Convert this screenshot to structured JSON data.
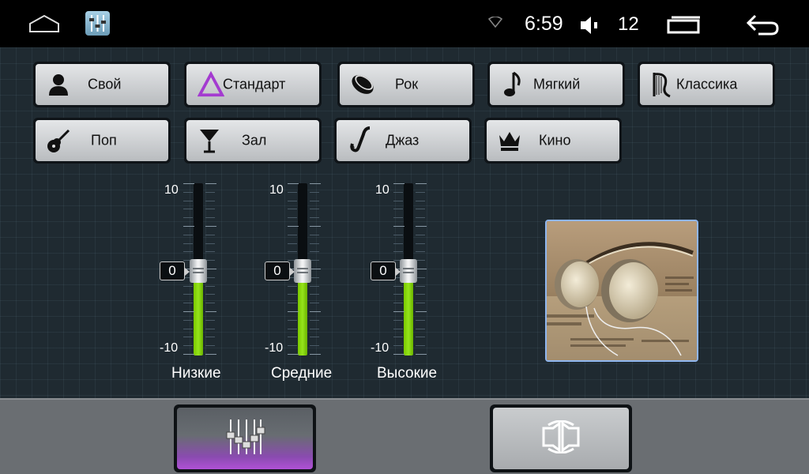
{
  "statusbar": {
    "time": "6:59",
    "volume": "12",
    "icons": [
      "home-icon",
      "equalizer-app-icon",
      "wifi-icon",
      "volume-icon",
      "recent-apps-icon",
      "back-icon"
    ]
  },
  "presets": [
    {
      "label": "Свой",
      "icon": "person-icon"
    },
    {
      "label": "Стандарт",
      "icon": "triangle-icon"
    },
    {
      "label": "Рок",
      "icon": "drum-icon"
    },
    {
      "label": "Мягкий",
      "icon": "music-note-icon"
    },
    {
      "label": "Классика",
      "icon": "harp-icon"
    },
    {
      "label": "Поп",
      "icon": "guitar-icon"
    },
    {
      "label": "Зал",
      "icon": "cocktail-glass-icon"
    },
    {
      "label": "Джаз",
      "icon": "saxophone-icon"
    },
    {
      "label": "Кино",
      "icon": "crown-icon"
    }
  ],
  "selected_preset": "Стандарт",
  "scale": {
    "max": "10",
    "min": "-10"
  },
  "bands": [
    {
      "label": "Низкие",
      "value": "0",
      "level": 0
    },
    {
      "label": "Средние",
      "value": "0",
      "level": 0
    },
    {
      "label": "Высокие",
      "value": "0",
      "level": 0
    }
  ],
  "colors": {
    "accent_purple": "#b051d6",
    "level_green": "#8fdc10",
    "selected_border": "#8fb6ee"
  },
  "bottom": {
    "left_icon": "equalizer-sliders-icon",
    "right_icon": "balance-fader-icon"
  }
}
